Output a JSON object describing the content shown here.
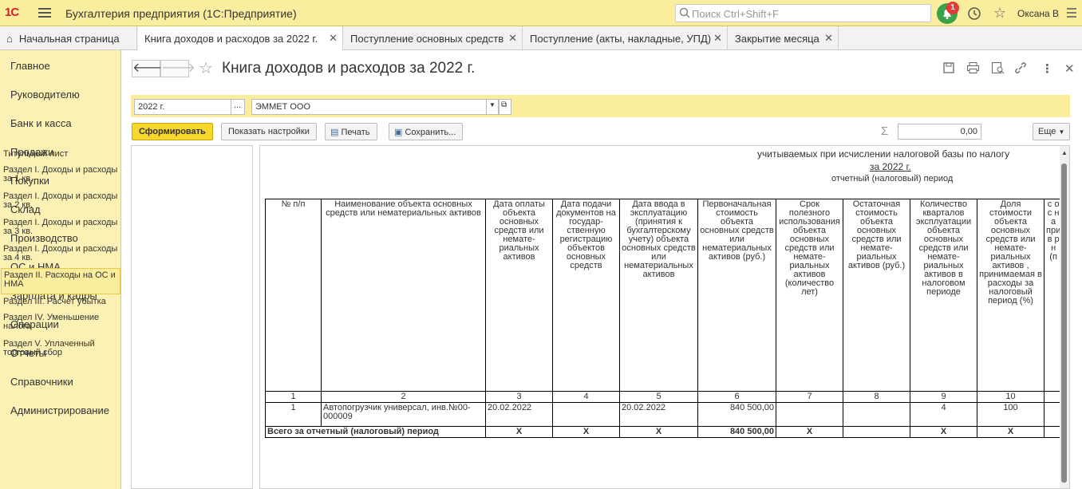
{
  "topbar": {
    "logo": "1С",
    "app_title": "Бухгалтерия предприятия  (1С:Предприятие)",
    "search_placeholder": "Поиск Ctrl+Shift+F",
    "notification_count": "1",
    "user_name": "Оксана В"
  },
  "tabs": [
    {
      "label": "Начальная страница"
    },
    {
      "label": "Книга доходов и расходов за 2022 г."
    },
    {
      "label": "Поступление основных средств"
    },
    {
      "label": "Поступление (акты, накладные, УПД)"
    },
    {
      "label": "Закрытие месяца"
    }
  ],
  "sidebar": {
    "items": [
      {
        "label": "Главное"
      },
      {
        "label": "Руководителю"
      },
      {
        "label": "Банк и касса"
      },
      {
        "label": "Продажи"
      },
      {
        "label": "Покупки"
      },
      {
        "label": "Склад"
      },
      {
        "label": "Производство"
      },
      {
        "label": "ОС и НМА"
      },
      {
        "label": "Зарплата и кадры"
      },
      {
        "label": "Операции"
      },
      {
        "label": "Отчеты"
      },
      {
        "label": "Справочники"
      },
      {
        "label": "Администрирование"
      }
    ]
  },
  "document": {
    "title": "Книга доходов и расходов за 2022 г.",
    "period_value": "2022 г.",
    "organization_value": "ЭММЕТ ООО",
    "buttons": {
      "generate": "Сформировать",
      "show_settings": "Показать настройки",
      "print": "Печать",
      "save": "Сохранить...",
      "more": "Еще"
    },
    "sum_value": "0,00"
  },
  "sections": [
    {
      "label": "Титульный лист"
    },
    {
      "label": "Раздел I. Доходы и расходы за 1 кв."
    },
    {
      "label": "Раздел I. Доходы и расходы за 2 кв."
    },
    {
      "label": "Раздел I. Доходы и расходы за 3 кв."
    },
    {
      "label": "Раздел I. Доходы и расходы за 4 кв."
    },
    {
      "label": "Раздел II. Расходы на ОС и НМА"
    },
    {
      "label": "Раздел III. Расчет убытка"
    },
    {
      "label": "Раздел IV. Уменьшение налога"
    },
    {
      "label": "Раздел V. Уплаченный торговый сбор"
    }
  ],
  "report": {
    "header_line": "учитываемых при исчислении налоговой базы по налогу",
    "period_line": "за 2022 г.",
    "period_caption": "отчетный (налоговый) период",
    "columns": [
      "№ п/п",
      "Наименование объекта основных средств или нематериальных активов",
      "Дата оплаты объекта основных средств или немате-риальных активов",
      "Дата подачи документов на государ-ственную регистрацию объектов основных средств",
      "Дата ввода в эксплуатацию (принятия к бухгалтерскому учету) объекта основных средств или нематериальных активов",
      "Первоначальная стоимость объекта основных средств или нематериальных активов (руб.)",
      "Срок полезного использования объекта основных средств или немате-риальных активов (количество лет)",
      "Остаточная стоимость объекта основных средств или немате-риальных активов (руб.)",
      "Количество кварталов эксплуатации объекта основных средств или немате-риальных активов в налоговом периоде",
      "Доля стоимости объекта основных средств или немате-риальных активов , принимаемая в расходы за налоговый период (%)",
      "с о с н а при в р н (п"
    ],
    "column_numbers": [
      "1",
      "2",
      "3",
      "4",
      "5",
      "6",
      "7",
      "8",
      "9",
      "10",
      ""
    ],
    "rows": [
      {
        "n": "1",
        "name": "Автопогрузчик универсал, инв.№00-000009",
        "pay_date": "20.02.2022",
        "reg_date": "",
        "start_date": "20.02.2022",
        "cost": "840 500,00",
        "life": "",
        "residual": "",
        "quarters": "4",
        "share": "100"
      }
    ],
    "total": {
      "label": "Всего за отчетный (налоговый) период",
      "pay_date": "X",
      "reg_date": "X",
      "start_date": "X",
      "cost": "840 500,00",
      "life": "X",
      "quarters": "X",
      "share": "X"
    }
  }
}
